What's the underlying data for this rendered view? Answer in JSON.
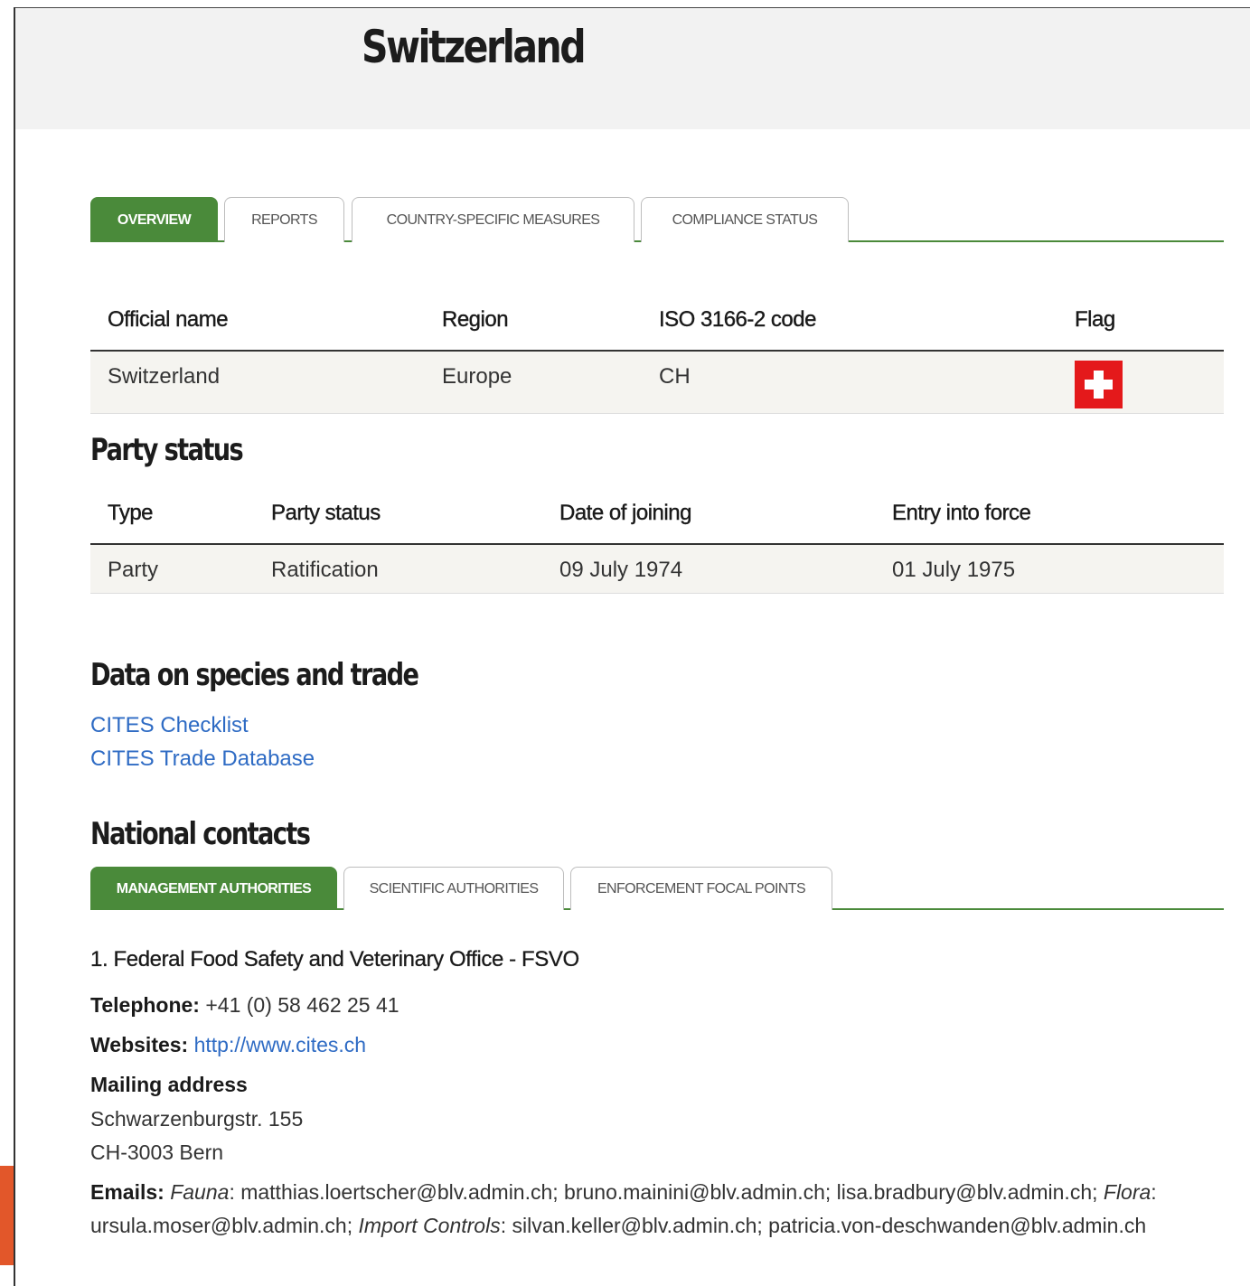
{
  "page": {
    "title": "Switzerland"
  },
  "main_tabs": [
    {
      "label": "OVERVIEW",
      "active": true
    },
    {
      "label": "REPORTS",
      "active": false
    },
    {
      "label": "COUNTRY-SPECIFIC MEASURES",
      "active": false
    },
    {
      "label": "COMPLIANCE STATUS",
      "active": false
    }
  ],
  "overview": {
    "headers": [
      "Official name",
      "Region",
      "ISO 3166-2 code",
      "Flag"
    ],
    "row": {
      "official_name": "Switzerland",
      "region": "Europe",
      "iso_code": "CH",
      "flag_icon": "swiss-flag-icon"
    }
  },
  "party_status": {
    "title": "Party status",
    "headers": [
      "Type",
      "Party status",
      "Date of joining",
      "Entry into force"
    ],
    "row": {
      "type": "Party",
      "party_status": "Ratification",
      "date_of_joining": "09 July 1974",
      "entry_into_force": "01 July 1975"
    }
  },
  "species_trade": {
    "title": "Data on species and trade",
    "links": [
      "CITES Checklist",
      "CITES Trade Database"
    ]
  },
  "national_contacts": {
    "title": "National contacts",
    "tabs": [
      {
        "label": "MANAGEMENT AUTHORITIES",
        "active": true
      },
      {
        "label": "SCIENTIFIC AUTHORITIES",
        "active": false
      },
      {
        "label": "ENFORCEMENT FOCAL POINTS",
        "active": false
      }
    ],
    "contact": {
      "org": "1. Federal Food Safety and Veterinary Office - FSVO",
      "telephone_label": "Telephone:",
      "telephone": "+41 (0) 58 462 25 41",
      "websites_label": "Websites:",
      "website": "http://www.cites.ch",
      "mailing_label": "Mailing address",
      "address_line1": "Schwarzenburgstr. 155",
      "address_line2": "CH-3003 Bern",
      "emails_label": "Emails:",
      "fauna_label": "Fauna",
      "fauna_emails": ": matthias.loertscher@blv.admin.ch; bruno.mainini@blv.admin.ch; lisa.bradbury@blv.admin.ch;",
      "flora_label": "Flora",
      "flora_emails": ": ursula.moser@blv.admin.ch; ",
      "import_label": "Import Controls",
      "import_emails": ": silvan.keller@blv.admin.ch; patricia.von-deschwanden@blv.admin.ch"
    }
  },
  "colors": {
    "accent": "#4a8a3a",
    "link": "#2e6bc4",
    "header_bg": "#f2f2f2",
    "flag_red": "#e4191b",
    "side_tab": "#e2572a"
  }
}
